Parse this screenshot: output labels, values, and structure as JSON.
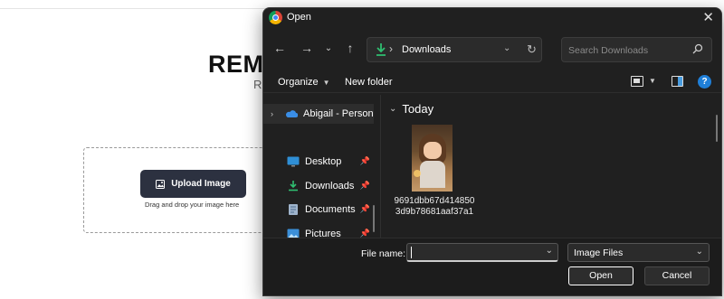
{
  "background_page": {
    "title": "REM",
    "subtitle": "R",
    "upload_button_label": "Upload Image",
    "drag_text": "Drag and drop your image here"
  },
  "dialog": {
    "title": "Open",
    "close_icon": "close-icon",
    "address": {
      "location": "Downloads"
    },
    "search": {
      "placeholder": "Search Downloads"
    },
    "toolbar": {
      "organize": "Organize",
      "new_folder": "New folder",
      "help": "?"
    },
    "nav_pane": {
      "items": [
        {
          "label": "Abigail - Person",
          "icon": "onedrive-icon",
          "selected": true
        },
        {
          "label": "Desktop",
          "icon": "desktop-icon",
          "pinned": true
        },
        {
          "label": "Downloads",
          "icon": "download-icon",
          "pinned": true
        },
        {
          "label": "Documents",
          "icon": "documents-icon",
          "pinned": true
        },
        {
          "label": "Pictures",
          "icon": "pictures-icon",
          "pinned": true
        }
      ]
    },
    "group": {
      "label": "Today"
    },
    "files": [
      {
        "name": "9691dbb67d4148503d9b78681aaf37a1",
        "type": "image"
      }
    ],
    "footer": {
      "file_name_label": "File name:",
      "file_name_value": "",
      "filter": "Image Files",
      "open": "Open",
      "cancel": "Cancel"
    }
  }
}
